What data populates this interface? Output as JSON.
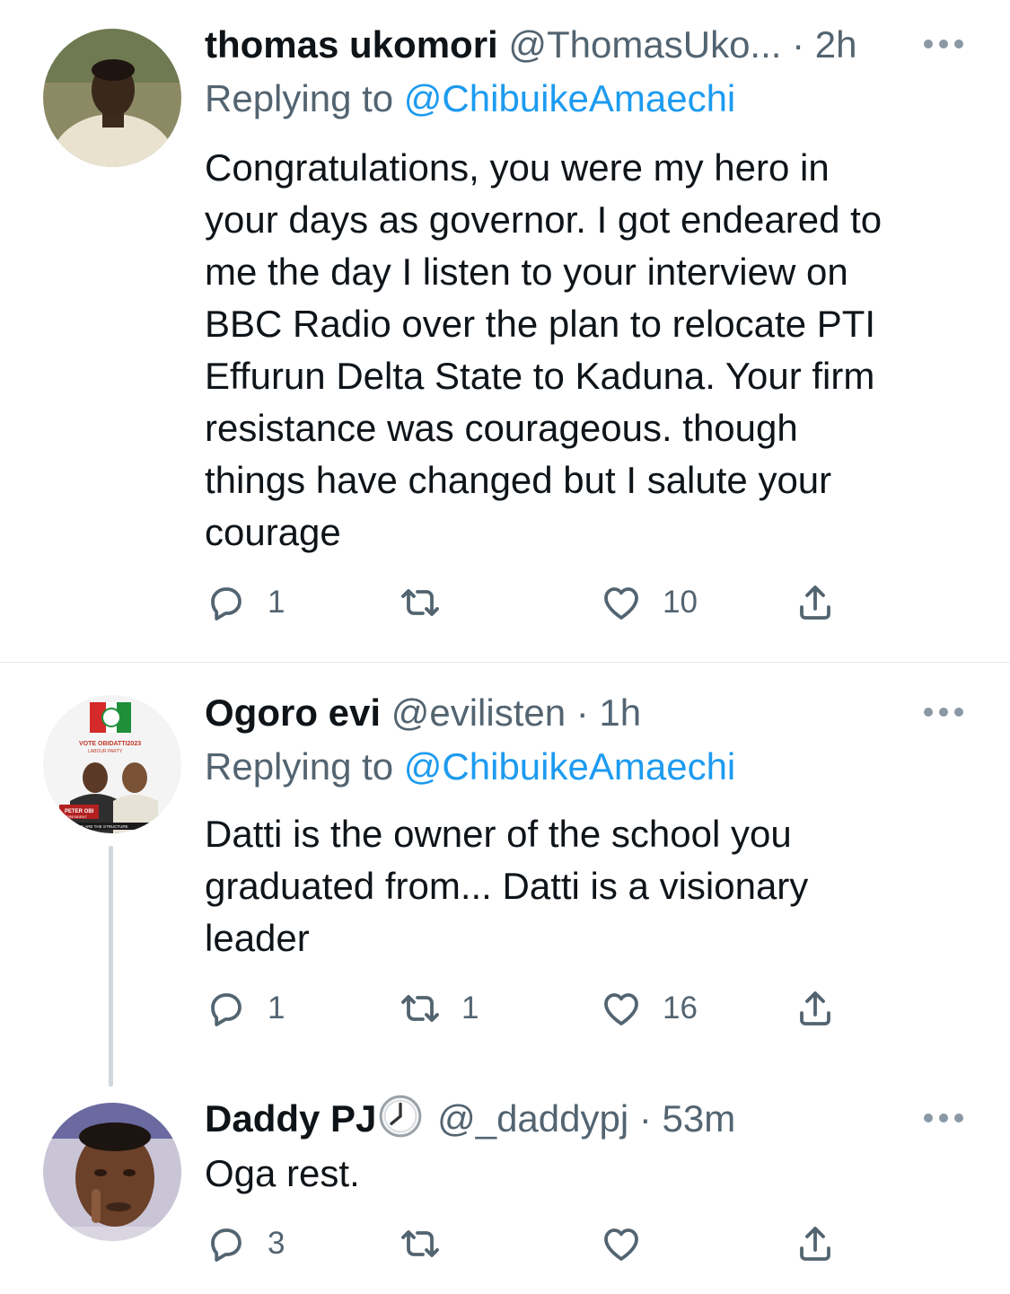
{
  "tweets": [
    {
      "name": "thomas ukomori",
      "handle": "@ThomasUko...",
      "time": "2h",
      "replying_prefix": "Replying to ",
      "replying_to": "@ChibuikeAmaechi",
      "text_lines": [
        "Congratulations, you were my hero in",
        "your days as governor. I got endeared to",
        "me the day I listen to your interview on",
        "BBC Radio over the plan to relocate PTI",
        "Effurun Delta State to Kaduna. Your firm",
        "resistance was courageous. though",
        "things have changed but I salute your",
        "courage"
      ],
      "replies": "1",
      "retweets": "",
      "likes": "10"
    },
    {
      "name": "Ogoro evi",
      "handle": "@evilisten",
      "time": "1h",
      "replying_prefix": "Replying to ",
      "replying_to": "@ChibuikeAmaechi",
      "text_lines": [
        "Datti is the owner of the school you",
        "graduated from... Datti is a visionary",
        "leader"
      ],
      "replies": "1",
      "retweets": "1",
      "likes": "16",
      "avatar_text": {
        "line1": "VOTE OBIDATTI2023",
        "line2": "LABOUR PARTY",
        "line3": "PETER OBI",
        "line4": "PRESIDENT",
        "line5": "WE ARE THE STRUCTURE"
      }
    },
    {
      "name": "Daddy PJ",
      "handle": "@_daddypj",
      "time": "53m",
      "text_lines": [
        "Oga rest."
      ],
      "replies": "3",
      "retweets": "",
      "likes": ""
    }
  ],
  "separator": " · ",
  "colors": {
    "text": "#0f1419",
    "secondary": "#536471",
    "link": "#1d9bf0",
    "divider": "#e1e8ed"
  },
  "icons": [
    "reply-icon",
    "retweet-icon",
    "like-icon",
    "share-icon",
    "more-icon",
    "clock-emoji-icon"
  ]
}
